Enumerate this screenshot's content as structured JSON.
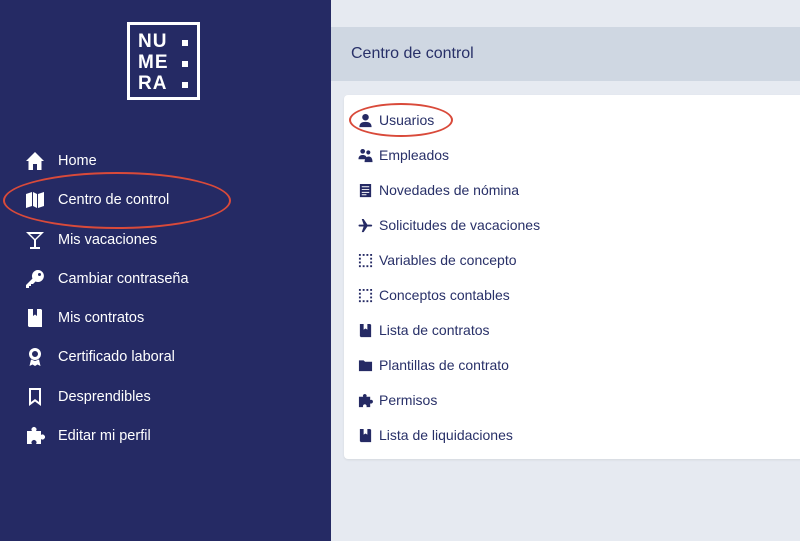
{
  "brand": {
    "logo_lines": "NU\nME\nRA"
  },
  "sidebar": {
    "items": [
      {
        "label": "Home",
        "icon": "home-icon"
      },
      {
        "label": "Centro de control",
        "icon": "map-icon"
      },
      {
        "label": "Mis vacaciones",
        "icon": "cocktail-icon"
      },
      {
        "label": "Cambiar contraseña",
        "icon": "key-icon"
      },
      {
        "label": "Mis contratos",
        "icon": "book-icon"
      },
      {
        "label": "Certificado laboral",
        "icon": "award-icon"
      },
      {
        "label": "Desprendibles",
        "icon": "bookmark-icon"
      },
      {
        "label": "Editar mi perfil",
        "icon": "puzzle-icon"
      }
    ]
  },
  "header": {
    "title": "Centro de control"
  },
  "control_menu": {
    "items": [
      {
        "label": "Usuarios",
        "icon": "user-icon"
      },
      {
        "label": "Empleados",
        "icon": "users-icon"
      },
      {
        "label": "Novedades de nómina",
        "icon": "newspaper-icon"
      },
      {
        "label": "Solicitudes de vacaciones",
        "icon": "plane-icon"
      },
      {
        "label": "Variables de concepto",
        "icon": "grid-icon"
      },
      {
        "label": "Conceptos contables",
        "icon": "grid-icon"
      },
      {
        "label": "Lista de contratos",
        "icon": "book-icon"
      },
      {
        "label": "Plantillas de contrato",
        "icon": "folder-icon"
      },
      {
        "label": "Permisos",
        "icon": "puzzle-icon"
      },
      {
        "label": "Lista de liquidaciones",
        "icon": "book-icon"
      }
    ]
  },
  "colors": {
    "sidebar": "#252a64",
    "highlight": "#d94a3a",
    "header": "#cfd7e2",
    "background": "#e6eaf1"
  }
}
